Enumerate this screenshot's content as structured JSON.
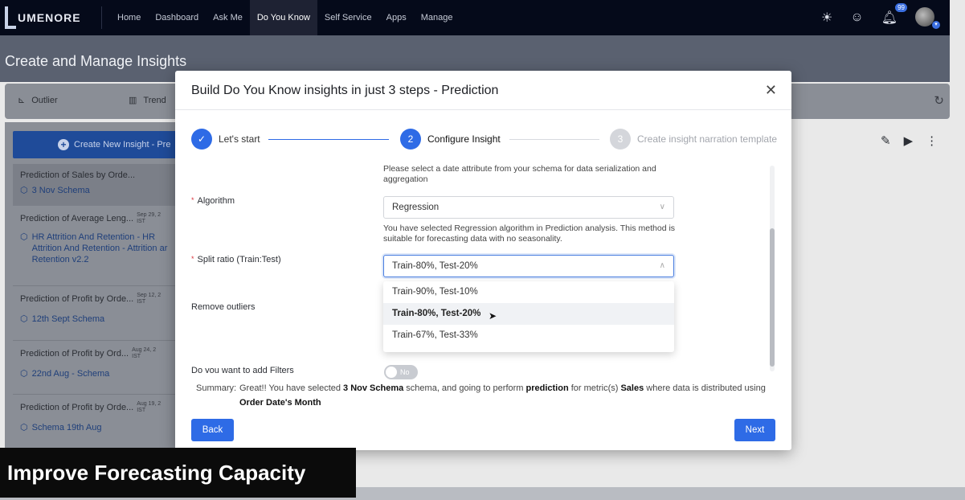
{
  "app": {
    "logo": "UMENORE"
  },
  "nav": {
    "items": [
      "Home",
      "Dashboard",
      "Ask Me",
      "Do You Know",
      "Self Service",
      "Apps",
      "Manage"
    ],
    "active_index": 3
  },
  "notifications": {
    "count": "99"
  },
  "page": {
    "title": "Create and Manage Insights"
  },
  "subnav": {
    "outlier": "Outlier",
    "trend": "Trend"
  },
  "left": {
    "create_label": "Create New Insight - Pre",
    "insights": [
      {
        "title": "Prediction of Sales by Orde...",
        "date": "",
        "tz": "",
        "schema": "3 Nov Schema"
      },
      {
        "title": "Prediction of Average Leng...",
        "date": "Sep 29, 2",
        "tz": "IST",
        "schema": "HR Attrition And Retention - HR Attrition And Retention - Attrition ar Retention v2.2"
      },
      {
        "title": "Prediction of Profit by Orde...",
        "date": "Sep 12, 2",
        "tz": "IST",
        "schema": "12th Sept Schema"
      },
      {
        "title": "Prediction of Profit by Ord...",
        "date": "Aug 24, 2",
        "tz": "IST",
        "schema": "22nd Aug - Schema"
      },
      {
        "title": "Prediction of Profit by Orde...",
        "date": "Aug 19, 2",
        "tz": "IST",
        "schema": "Schema 19th Aug"
      }
    ]
  },
  "modal": {
    "title": "Build Do You Know insights in just 3 steps - Prediction",
    "steps": [
      {
        "number": "",
        "label": "Let's start",
        "status": "done"
      },
      {
        "number": "2",
        "label": "Configure Insight",
        "status": "active"
      },
      {
        "number": "3",
        "label": "Create insight narration template",
        "status": "pending"
      }
    ],
    "date_help": "Please select a date attribute from your schema for data serialization and aggregation",
    "algorithm": {
      "label": "Algorithm",
      "value": "Regression",
      "help": "You have selected Regression algorithm in Prediction analysis. This method is suitable for forecasting data with no seasonality."
    },
    "split": {
      "label": "Split ratio (Train:Test)",
      "value": "Train-80%, Test-20%",
      "options": [
        "Train-90%, Test-10%",
        "Train-80%, Test-20%",
        "Train-67%, Test-33%"
      ],
      "highlighted_index": 1
    },
    "remove_outliers": {
      "label": "Remove outliers"
    },
    "filters": {
      "label": "Do you want to add Filters",
      "toggle": "No"
    },
    "summary": {
      "label": "Summary:",
      "p1": "Great!! You have selected ",
      "schema": "3 Nov Schema",
      "p2": " schema, and going to perform ",
      "analysis": "prediction",
      "p3": " for metric(s) ",
      "metric": "Sales",
      "p4": " where data is distributed using ",
      "attribute": "Order Date's Month"
    },
    "back_label": "Back",
    "next_label": "Next"
  },
  "caption": "Improve Forecasting Capacity",
  "colors": {
    "primary": "#2e6be6",
    "nav_bg": "#050a1a",
    "caption_bg": "#0b0b0b"
  }
}
